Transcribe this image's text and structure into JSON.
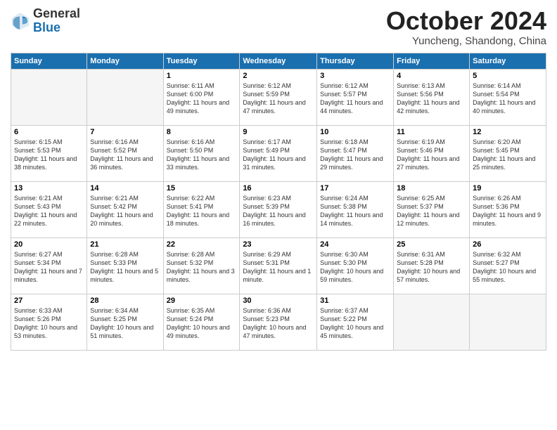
{
  "header": {
    "logo_line1": "General",
    "logo_line2": "Blue",
    "month": "October 2024",
    "location": "Yuncheng, Shandong, China"
  },
  "weekdays": [
    "Sunday",
    "Monday",
    "Tuesday",
    "Wednesday",
    "Thursday",
    "Friday",
    "Saturday"
  ],
  "weeks": [
    [
      {
        "day": "",
        "info": ""
      },
      {
        "day": "",
        "info": ""
      },
      {
        "day": "1",
        "info": "Sunrise: 6:11 AM\nSunset: 6:00 PM\nDaylight: 11 hours and 49 minutes."
      },
      {
        "day": "2",
        "info": "Sunrise: 6:12 AM\nSunset: 5:59 PM\nDaylight: 11 hours and 47 minutes."
      },
      {
        "day": "3",
        "info": "Sunrise: 6:12 AM\nSunset: 5:57 PM\nDaylight: 11 hours and 44 minutes."
      },
      {
        "day": "4",
        "info": "Sunrise: 6:13 AM\nSunset: 5:56 PM\nDaylight: 11 hours and 42 minutes."
      },
      {
        "day": "5",
        "info": "Sunrise: 6:14 AM\nSunset: 5:54 PM\nDaylight: 11 hours and 40 minutes."
      }
    ],
    [
      {
        "day": "6",
        "info": "Sunrise: 6:15 AM\nSunset: 5:53 PM\nDaylight: 11 hours and 38 minutes."
      },
      {
        "day": "7",
        "info": "Sunrise: 6:16 AM\nSunset: 5:52 PM\nDaylight: 11 hours and 36 minutes."
      },
      {
        "day": "8",
        "info": "Sunrise: 6:16 AM\nSunset: 5:50 PM\nDaylight: 11 hours and 33 minutes."
      },
      {
        "day": "9",
        "info": "Sunrise: 6:17 AM\nSunset: 5:49 PM\nDaylight: 11 hours and 31 minutes."
      },
      {
        "day": "10",
        "info": "Sunrise: 6:18 AM\nSunset: 5:47 PM\nDaylight: 11 hours and 29 minutes."
      },
      {
        "day": "11",
        "info": "Sunrise: 6:19 AM\nSunset: 5:46 PM\nDaylight: 11 hours and 27 minutes."
      },
      {
        "day": "12",
        "info": "Sunrise: 6:20 AM\nSunset: 5:45 PM\nDaylight: 11 hours and 25 minutes."
      }
    ],
    [
      {
        "day": "13",
        "info": "Sunrise: 6:21 AM\nSunset: 5:43 PM\nDaylight: 11 hours and 22 minutes."
      },
      {
        "day": "14",
        "info": "Sunrise: 6:21 AM\nSunset: 5:42 PM\nDaylight: 11 hours and 20 minutes."
      },
      {
        "day": "15",
        "info": "Sunrise: 6:22 AM\nSunset: 5:41 PM\nDaylight: 11 hours and 18 minutes."
      },
      {
        "day": "16",
        "info": "Sunrise: 6:23 AM\nSunset: 5:39 PM\nDaylight: 11 hours and 16 minutes."
      },
      {
        "day": "17",
        "info": "Sunrise: 6:24 AM\nSunset: 5:38 PM\nDaylight: 11 hours and 14 minutes."
      },
      {
        "day": "18",
        "info": "Sunrise: 6:25 AM\nSunset: 5:37 PM\nDaylight: 11 hours and 12 minutes."
      },
      {
        "day": "19",
        "info": "Sunrise: 6:26 AM\nSunset: 5:36 PM\nDaylight: 11 hours and 9 minutes."
      }
    ],
    [
      {
        "day": "20",
        "info": "Sunrise: 6:27 AM\nSunset: 5:34 PM\nDaylight: 11 hours and 7 minutes."
      },
      {
        "day": "21",
        "info": "Sunrise: 6:28 AM\nSunset: 5:33 PM\nDaylight: 11 hours and 5 minutes."
      },
      {
        "day": "22",
        "info": "Sunrise: 6:28 AM\nSunset: 5:32 PM\nDaylight: 11 hours and 3 minutes."
      },
      {
        "day": "23",
        "info": "Sunrise: 6:29 AM\nSunset: 5:31 PM\nDaylight: 11 hours and 1 minute."
      },
      {
        "day": "24",
        "info": "Sunrise: 6:30 AM\nSunset: 5:30 PM\nDaylight: 10 hours and 59 minutes."
      },
      {
        "day": "25",
        "info": "Sunrise: 6:31 AM\nSunset: 5:28 PM\nDaylight: 10 hours and 57 minutes."
      },
      {
        "day": "26",
        "info": "Sunrise: 6:32 AM\nSunset: 5:27 PM\nDaylight: 10 hours and 55 minutes."
      }
    ],
    [
      {
        "day": "27",
        "info": "Sunrise: 6:33 AM\nSunset: 5:26 PM\nDaylight: 10 hours and 53 minutes."
      },
      {
        "day": "28",
        "info": "Sunrise: 6:34 AM\nSunset: 5:25 PM\nDaylight: 10 hours and 51 minutes."
      },
      {
        "day": "29",
        "info": "Sunrise: 6:35 AM\nSunset: 5:24 PM\nDaylight: 10 hours and 49 minutes."
      },
      {
        "day": "30",
        "info": "Sunrise: 6:36 AM\nSunset: 5:23 PM\nDaylight: 10 hours and 47 minutes."
      },
      {
        "day": "31",
        "info": "Sunrise: 6:37 AM\nSunset: 5:22 PM\nDaylight: 10 hours and 45 minutes."
      },
      {
        "day": "",
        "info": ""
      },
      {
        "day": "",
        "info": ""
      }
    ]
  ]
}
